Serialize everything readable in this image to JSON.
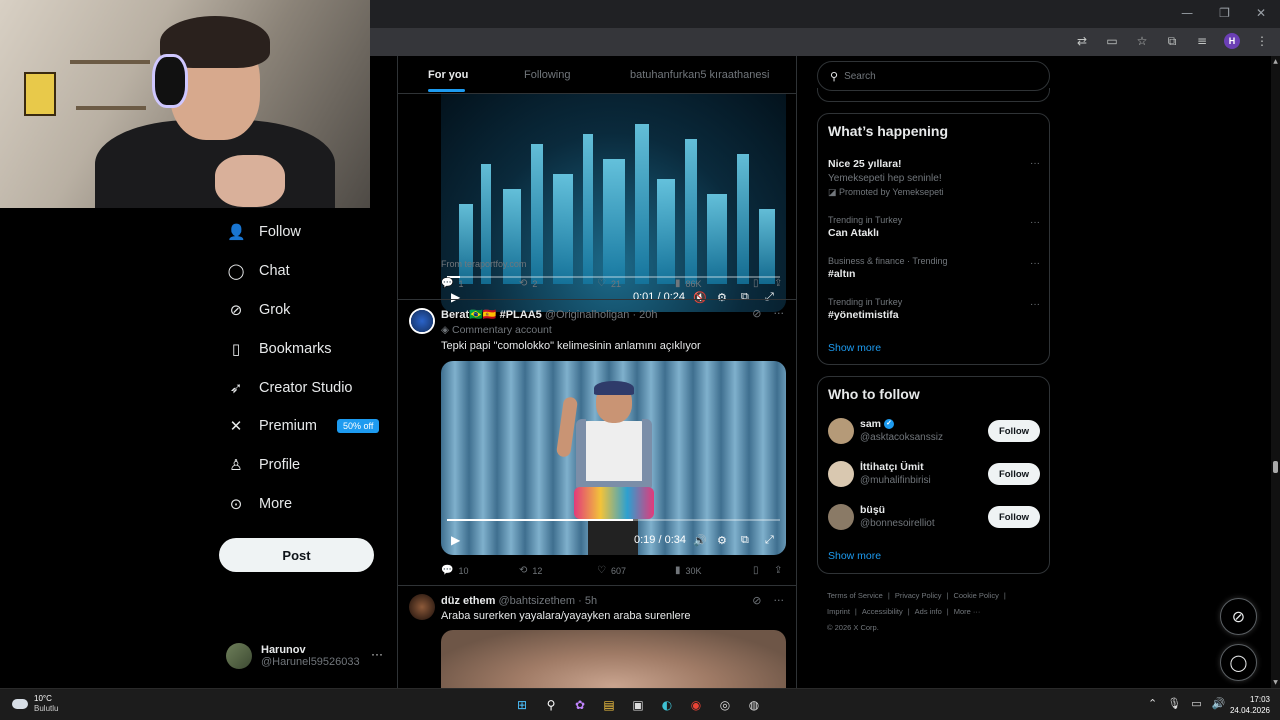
{
  "browser": {
    "window_controls": [
      "—",
      "❐",
      "✕"
    ],
    "profile_initial": "H"
  },
  "nav": {
    "items": [
      {
        "icon": "person-plus-icon",
        "glyph": "👤",
        "label": "Follow"
      },
      {
        "icon": "chat-icon",
        "glyph": "◯",
        "label": "Chat"
      },
      {
        "icon": "grok-icon",
        "glyph": "⊘",
        "label": "Grok"
      },
      {
        "icon": "bookmark-icon",
        "glyph": "▯",
        "label": "Bookmarks"
      },
      {
        "icon": "rocket-icon",
        "glyph": "➶",
        "label": "Creator Studio"
      },
      {
        "icon": "x-logo-icon",
        "glyph": "𝕏",
        "label": "Premium"
      },
      {
        "icon": "profile-icon",
        "glyph": "♙",
        "label": "Profile"
      },
      {
        "icon": "more-circle-icon",
        "glyph": "⋯",
        "label": "More"
      }
    ],
    "premium_badge": "50% off",
    "post_label": "Post"
  },
  "account": {
    "name": "Harunov",
    "handle": "@Harunel59526033",
    "more": "···"
  },
  "timeline": {
    "tabs": [
      "For you",
      "Following",
      "batuhanfurkan5 kıraathanesi"
    ],
    "tweet1": {
      "video_time": "0:01 / 0:24",
      "video_progress": 0.04,
      "from": "From teraportfoy.com",
      "replies": "1",
      "reposts": "2",
      "likes": "21",
      "views": "86K"
    },
    "tweet2": {
      "name": "Berat🇧🇷🇪🇸 #PLAA5",
      "handle": "@Originalholigan",
      "time": "· 20h",
      "label": "Commentary account",
      "text": "Tepki papi \"comolokko\" kelimesinin anlamını açıklıyor",
      "video_time": "0:19 / 0:34",
      "video_progress": 0.56,
      "replies": "10",
      "reposts": "12",
      "likes": "607",
      "views": "30K"
    },
    "tweet3": {
      "name": "düz ethem",
      "handle": "@bahtsizethem",
      "time": "· 5h",
      "text": "Araba surerken yayalara/yayayken araba surenlere"
    }
  },
  "search": {
    "placeholder": "Search"
  },
  "whats_happening": {
    "title": "What’s happening",
    "trends": [
      {
        "meta": "",
        "name": "Nice 25 yıllara!",
        "sub": "Yemeksepeti hep seninle!",
        "promo": "Promoted by Yemeksepeti"
      },
      {
        "meta": "Trending in Turkey",
        "name": "Can Ataklı"
      },
      {
        "meta": "Business & finance · Trending",
        "name": "#altın"
      },
      {
        "meta": "Trending in Turkey",
        "name": "#yönetimistifa"
      }
    ],
    "show_more": "Show more"
  },
  "who_to_follow": {
    "title": "Who to follow",
    "accounts": [
      {
        "name": "sam",
        "handle": "@asktacoksanssiz",
        "verified": true,
        "avatar_color": "#b59a78"
      },
      {
        "name": "İttihatçı Ümit",
        "handle": "@muhalifinbirisi",
        "verified": false,
        "avatar_color": "#d9c8b0"
      },
      {
        "name": "büşü",
        "handle": "@bonnesoirelliot",
        "verified": false,
        "avatar_color": "#8a7a66"
      }
    ],
    "follow_label": "Follow",
    "show_more": "Show more"
  },
  "footer": {
    "links": [
      "Terms of Service",
      "Privacy Policy",
      "Cookie Policy",
      "Imprint",
      "Accessibility",
      "Ads info",
      "More ···"
    ],
    "copyright": "© 2026 X Corp."
  },
  "taskbar": {
    "temperature": "10°C",
    "condition": "Bulutlu",
    "time": "17:03",
    "date": "24.04.2026"
  },
  "colors": {
    "accent": "#1d9bf0",
    "background": "#000000",
    "border": "#2f3336",
    "muted_text": "#71767b"
  }
}
